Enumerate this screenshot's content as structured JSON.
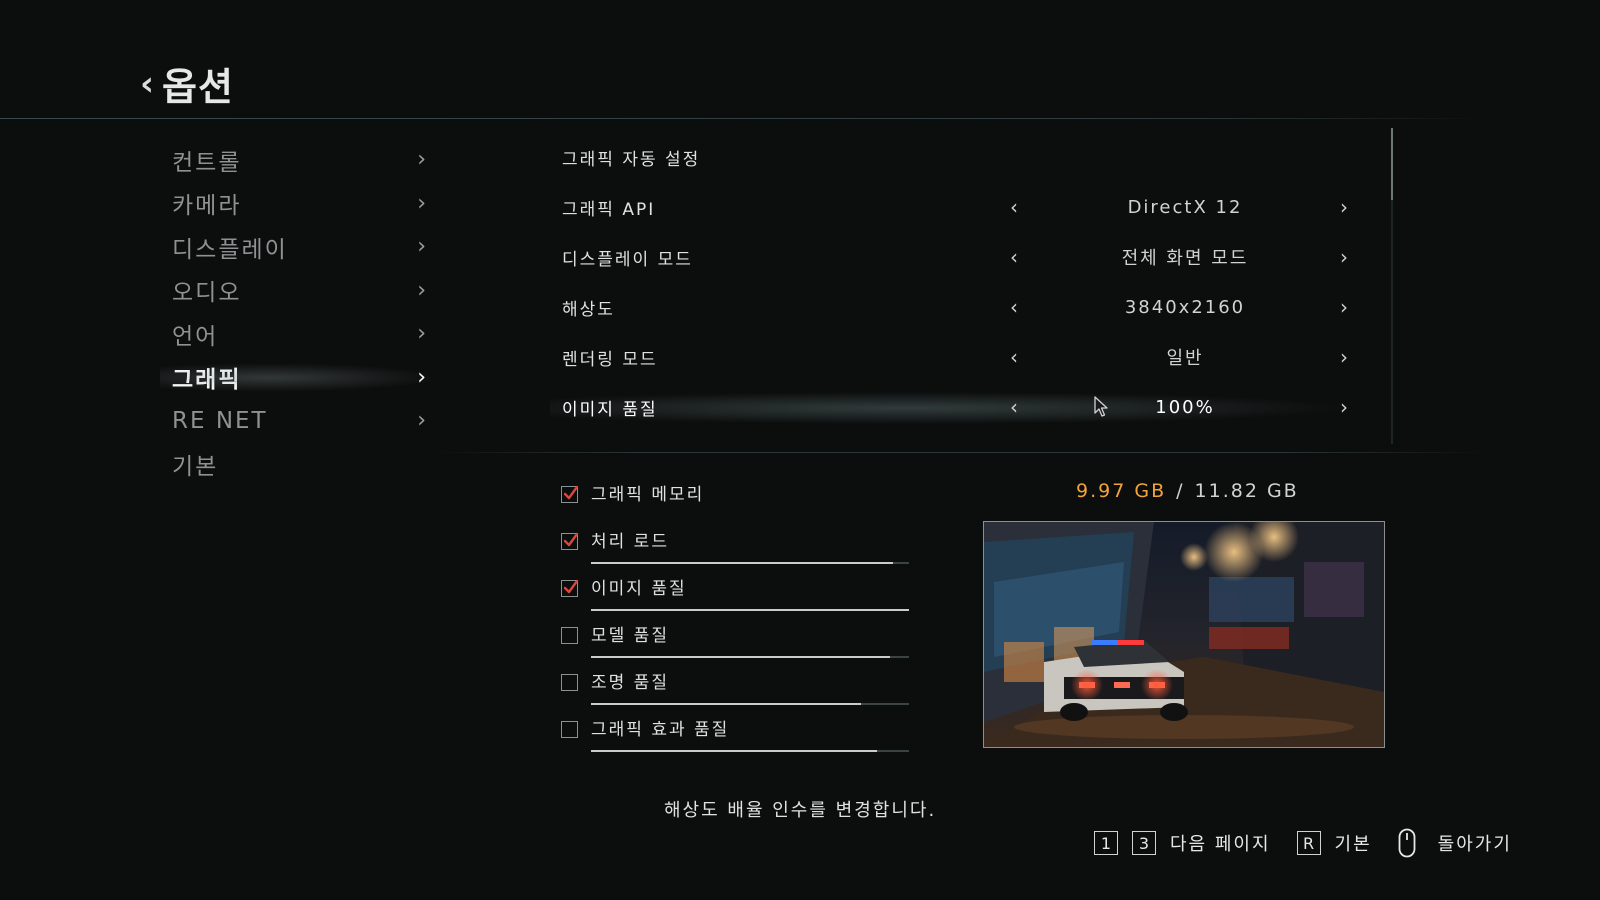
{
  "header": {
    "back_icon": "chevron-left-icon",
    "title": "옵션"
  },
  "sidebar": {
    "items": [
      {
        "label": "컨트롤",
        "arrow": "›"
      },
      {
        "label": "카메라",
        "arrow": "›"
      },
      {
        "label": "디스플레이",
        "arrow": "›"
      },
      {
        "label": "오디오",
        "arrow": "›"
      },
      {
        "label": "언어",
        "arrow": "›"
      },
      {
        "label": "그래픽",
        "arrow": "›",
        "active": true
      },
      {
        "label": "RE NET",
        "arrow": "›"
      },
      {
        "label": "기본"
      }
    ]
  },
  "settings": {
    "rows": [
      {
        "label": "그래픽 자동 설정"
      },
      {
        "label": "그래픽 API",
        "left": "‹",
        "value": "DirectX 12",
        "right": "›"
      },
      {
        "label": "디스플레이 모드",
        "left": "‹",
        "value": "전체 화면 모드",
        "right": "›"
      },
      {
        "label": "해상도",
        "left": "‹",
        "value": "3840x2160",
        "right": "›"
      },
      {
        "label": "렌더링 모드",
        "left": "‹",
        "value": "일반",
        "right": "›"
      },
      {
        "label": "이미지 품질",
        "left": "‹",
        "value": "100%",
        "right": "›",
        "active": true
      }
    ]
  },
  "memory": {
    "used": "9.97 GB",
    "separator": "/",
    "total": "11.82 GB",
    "used_color": "#f0a43a"
  },
  "load_checks": [
    {
      "label": "그래픽 메모리",
      "checked": true
    },
    {
      "label": "처리 로드",
      "checked": true,
      "level": 0.95
    },
    {
      "label": "이미지 품질",
      "checked": true,
      "level": 1.0
    },
    {
      "label": "모델 품질",
      "checked": false,
      "level": 0.94
    },
    {
      "label": "조명 품질",
      "checked": false,
      "level": 0.85
    },
    {
      "label": "그래픽 효과 품질",
      "checked": false,
      "level": 0.9
    }
  ],
  "hint": "해상도 배율 인수를 변경합니다.",
  "footer": {
    "key1": "1",
    "key2": "3",
    "next_label": "다음 페이지",
    "key_r": "R",
    "default_label": "기본",
    "mouse_icon": "mouse-icon",
    "back_label": "돌아가기"
  },
  "colors": {
    "accent_orange": "#f0a43a",
    "check_red": "#d9473f",
    "background": "#0c0d0d"
  }
}
